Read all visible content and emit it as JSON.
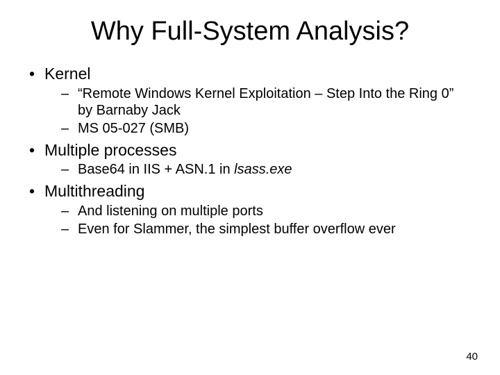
{
  "title": "Why Full-System Analysis?",
  "sections": [
    {
      "heading": "Kernel",
      "items": [
        "“Remote Windows Kernel Exploitation – Step Into the Ring 0” by Barnaby Jack",
        "MS 05-027 (SMB)"
      ]
    },
    {
      "heading": "Multiple processes",
      "items": [
        "Base64 in IIS + ASN.1 in "
      ],
      "italic_suffix": "lsass.exe"
    },
    {
      "heading": "Multithreading",
      "items": [
        "And listening on multiple ports",
        "Even for Slammer, the simplest buffer overflow ever"
      ]
    }
  ],
  "page_number": "40"
}
